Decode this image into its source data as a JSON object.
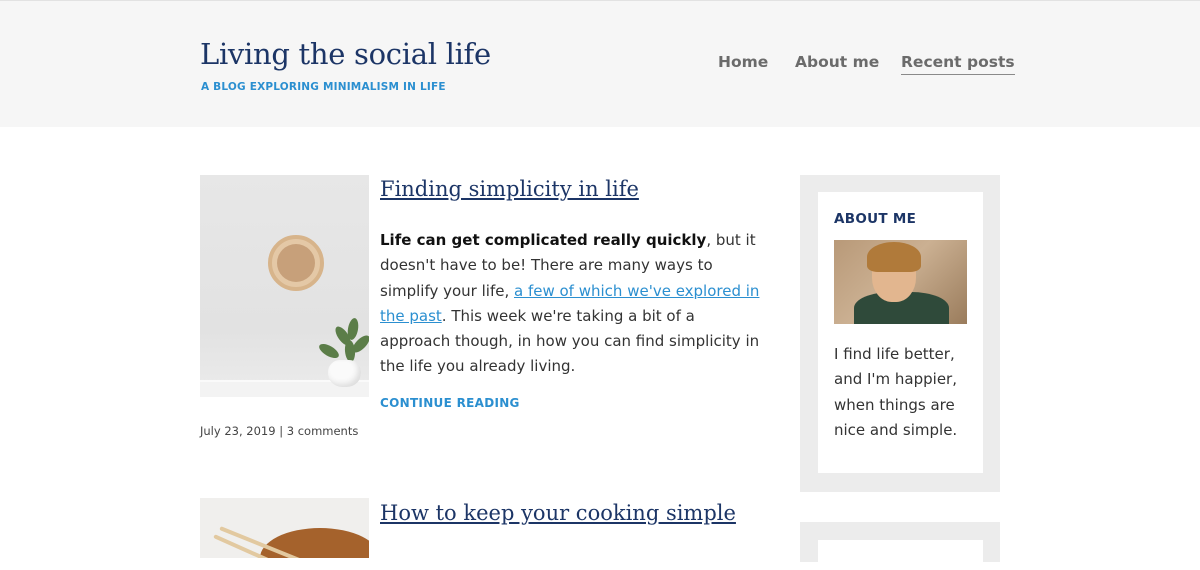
{
  "site": {
    "title": "Living the social life",
    "tagline": "A BLOG EXPLORING MINIMALISM IN LIFE"
  },
  "nav": {
    "items": [
      {
        "label": "Home"
      },
      {
        "label": "About me"
      },
      {
        "label": "Recent posts",
        "active": true
      }
    ]
  },
  "posts": [
    {
      "title": "Finding simplicity in life",
      "body_bold": "Life can get complicated really quickly",
      "body_part1": ", but it doesn't have to be! There are many ways to simplify your life, ",
      "link_text": "a few of which we've explored in the past",
      "body_part2": ". This week we're taking a bit of a approach though, in how you can find simplicity in the life you already living.",
      "continue_label": "CONTINUE READING",
      "meta": "July 23, 2019 | 3 comments",
      "image": "wall-clock-and-plant"
    },
    {
      "title": "How to keep your cooking simple",
      "image": "wooden-bowl-with-chopsticks"
    }
  ],
  "sidebar": {
    "about": {
      "heading": "ABOUT ME",
      "image": "smiling-man-portrait",
      "text": "I find life better, and I'm happier, when things are nice and simple."
    }
  },
  "colors": {
    "header_bg": "#f6f6f6",
    "title": "#1c3566",
    "accent": "#2b8fd0",
    "nav": "#6b6b6b",
    "sidebar_bg": "#ececec"
  }
}
